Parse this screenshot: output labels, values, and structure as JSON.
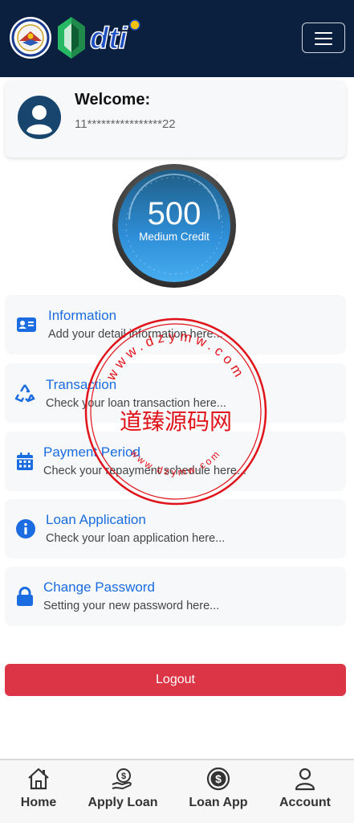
{
  "header": {
    "brand_text": "dti"
  },
  "welcome": {
    "title": "Welcome:",
    "account_masked": "11****************22"
  },
  "credit": {
    "score": "500",
    "level": "Medium Credit"
  },
  "menu": [
    {
      "icon": "id-card-icon",
      "title": "Information",
      "subtitle": "Add your detail information here..."
    },
    {
      "icon": "recycle-icon",
      "title": "Transaction",
      "subtitle": "Check your loan transaction here..."
    },
    {
      "icon": "calendar-icon",
      "title": "Payment Period",
      "subtitle": "Check your repayment schedule here..."
    },
    {
      "icon": "info-circle-icon",
      "title": "Loan Application",
      "subtitle": "Check your loan application here..."
    },
    {
      "icon": "lock-icon",
      "title": "Change Password",
      "subtitle": "Setting your new password here..."
    }
  ],
  "logout_label": "Logout",
  "tabs": [
    {
      "icon": "home-icon",
      "label": "Home"
    },
    {
      "icon": "money-hand-icon",
      "label": "Apply Loan"
    },
    {
      "icon": "dollar-coin-icon",
      "label": "Loan App"
    },
    {
      "icon": "user-icon",
      "label": "Account"
    }
  ],
  "watermark": {
    "chinese": "道臻源码网",
    "url_text": "www.dzymw.com"
  },
  "colors": {
    "header_bg": "#0b1f3f",
    "accent_blue": "#1a6ce0",
    "logout_red": "#dc3545",
    "gauge_blue": "#2f8fd8"
  }
}
